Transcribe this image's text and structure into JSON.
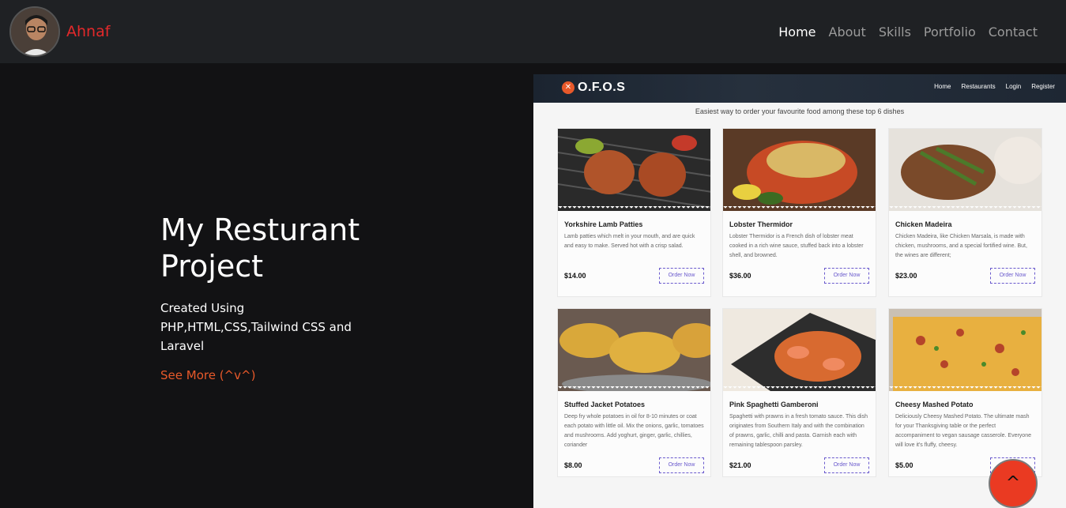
{
  "navbar": {
    "brand": "Ahnaf",
    "links": [
      "Home",
      "About",
      "Skills",
      "Portfolio",
      "Contact"
    ],
    "active": "Home"
  },
  "hero": {
    "title": "My Resturant Project",
    "subtitle": "Created Using PHP,HTML,CSS,Tailwind CSS and Laravel",
    "link": "See More (^v^)"
  },
  "preview": {
    "logo": "O.F.O.S",
    "nav": [
      "Home",
      "Restaurants",
      "Login",
      "Register"
    ],
    "tagline": "Easiest way to order your favourite food among these top 6 dishes",
    "order_label": "Order Now",
    "dishes": [
      {
        "name": "Yorkshire Lamb Patties",
        "desc": "Lamb patties which melt in your mouth, and are quick and easy to make. Served hot with a crisp salad.",
        "price": "$14.00",
        "image": "grilled-patties-photo"
      },
      {
        "name": "Lobster Thermidor",
        "desc": "Lobster Thermidor is a French dish of lobster meat cooked in a rich wine sauce, stuffed back into a lobster shell, and browned.",
        "price": "$36.00",
        "image": "lobster-photo"
      },
      {
        "name": "Chicken Madeira",
        "desc": "Chicken Madeira, like Chicken Marsala, is made with chicken, mushrooms, and a special fortified wine. But, the wines are different;",
        "price": "$23.00",
        "image": "chicken-madeira-photo"
      },
      {
        "name": "Stuffed Jacket Potatoes",
        "desc": "Deep fry whole potatoes in oil for 8-10 minutes or coat each potato with little oil. Mix the onions, garlic, tomatoes and mushrooms. Add yoghurt, ginger, garlic, chillies, coriander",
        "price": "$8.00",
        "image": "stuffed-potatoes-photo"
      },
      {
        "name": "Pink Spaghetti Gamberoni",
        "desc": "Spaghetti with prawns in a fresh tomato sauce. This dish originates from Southern Italy and with the combination of prawns, garlic, chilli and pasta. Garnish each with remaining tablespoon parsley.",
        "price": "$21.00",
        "image": "spaghetti-prawns-photo"
      },
      {
        "name": "Cheesy Mashed Potato",
        "desc": "Deliciously Cheesy Mashed Potato. The ultimate mash for your Thanksgiving table or the perfect accompaniment to vegan sausage casserole. Everyone will love it's fluffy, cheesy.",
        "price": "$5.00",
        "image": "cheesy-mash-photo"
      }
    ]
  },
  "fab": {
    "label": "^"
  },
  "colors": {
    "accent": "#e8592a",
    "brand": "#e3292b",
    "fab": "#ea3a22",
    "nav_bg": "#1f2124",
    "page_bg": "#121214"
  }
}
